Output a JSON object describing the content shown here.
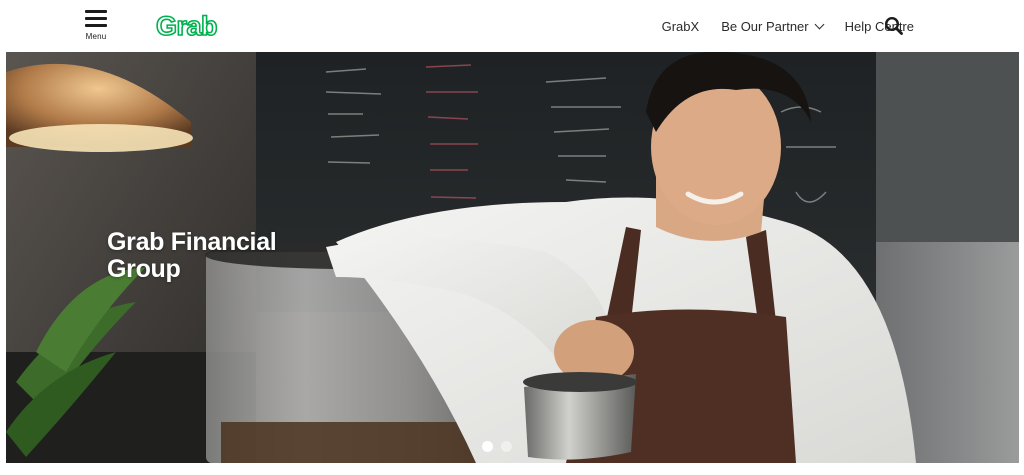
{
  "header": {
    "menu_label": "Menu",
    "logo_text": "Grab",
    "brand_color": "#00b14f",
    "nav": [
      {
        "label": "GrabX"
      },
      {
        "label": "Be Our Partner",
        "has_dropdown": true
      },
      {
        "label": "Help Centre"
      }
    ],
    "search_icon": "search-icon"
  },
  "hero": {
    "title_line1": "Grab Financial",
    "title_line2": "Group",
    "image_alt": "barista-pouring-milk",
    "carousel": {
      "active": 1,
      "count": 2
    }
  }
}
